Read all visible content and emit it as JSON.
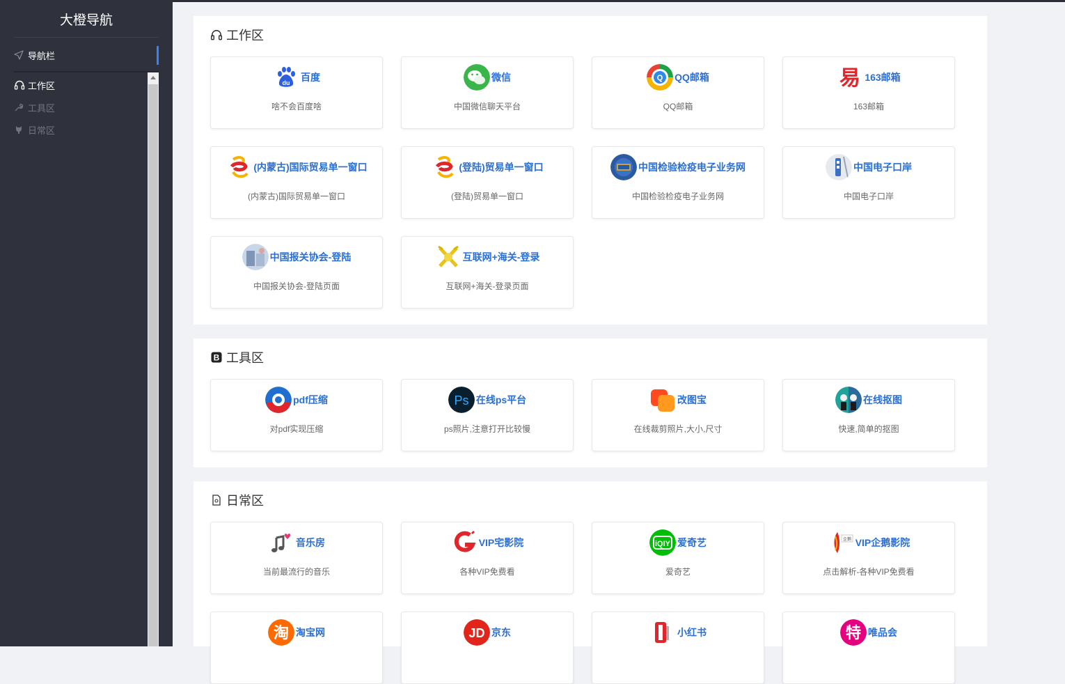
{
  "brand": "大橙导航",
  "nav": {
    "header_label": "导航栏",
    "items": [
      {
        "label": "工作区",
        "icon": "headset-icon",
        "active": true
      },
      {
        "label": "工具区",
        "icon": "wrench-icon",
        "active": false
      },
      {
        "label": "日常区",
        "icon": "github-icon",
        "active": false
      }
    ]
  },
  "sections": [
    {
      "title": "工作区",
      "icon": "headset-icon",
      "cards": [
        {
          "title": "百度",
          "desc": "啥不会百度啥",
          "logo": "baidu-logo"
        },
        {
          "title": "微信",
          "desc": "中国微信聊天平台",
          "logo": "wechat-logo"
        },
        {
          "title": "QQ邮箱",
          "desc": "QQ邮箱",
          "logo": "qq-mail-logo"
        },
        {
          "title": "163邮箱",
          "desc": "163邮箱",
          "logo": "netease-163-logo"
        },
        {
          "title": "(内蒙古)国际贸易单一窗口",
          "desc": "(内蒙古)国际贸易单一窗口",
          "logo": "single-window-logo"
        },
        {
          "title": "(登陆)贸易单一窗口",
          "desc": "(登陆)贸易单一窗口",
          "logo": "single-window-logo"
        },
        {
          "title": "中国检验检疫电子业务网",
          "desc": "中国检验检疫电子业务网",
          "logo": "ciq-logo"
        },
        {
          "title": "中国电子口岸",
          "desc": "中国电子口岸",
          "logo": "chinaport-logo"
        },
        {
          "title": "中国报关协会-登陆",
          "desc": "中国报关协会-登陆页面",
          "logo": "customs-assoc-logo"
        },
        {
          "title": "互联网+海关-登录",
          "desc": "互联网+海关-登录页面",
          "logo": "customs-emblem-logo"
        }
      ]
    },
    {
      "title": "工具区",
      "icon": "b-square-icon",
      "cards": [
        {
          "title": "pdf压缩",
          "desc": "对pdf实现压缩",
          "logo": "pdf-compress-logo"
        },
        {
          "title": "在线ps平台",
          "desc": "ps照片,注意打开比较慢",
          "logo": "photoshop-logo"
        },
        {
          "title": "改图宝",
          "desc": "在线裁剪照片,大小,尺寸",
          "logo": "gaitubao-logo"
        },
        {
          "title": "在线抠图",
          "desc": "快速,简单的抠图",
          "logo": "cutout-logo"
        }
      ]
    },
    {
      "title": "日常区",
      "icon": "document-icon",
      "cards": [
        {
          "title": "音乐房",
          "desc": "当前最流行的音乐",
          "logo": "music-logo"
        },
        {
          "title": "VIP宅影院",
          "desc": "各种VIP免费看",
          "logo": "vip-cinema-logo"
        },
        {
          "title": "爱奇艺",
          "desc": "爱奇艺",
          "logo": "iqiyi-logo"
        },
        {
          "title": "VIP企鹅影院",
          "desc": "点击解析-各种VIP免费看",
          "logo": "penguin-cinema-logo"
        },
        {
          "title": "淘宝网",
          "desc": "",
          "logo": "taobao-logo"
        },
        {
          "title": "京东",
          "desc": "",
          "logo": "jd-logo"
        },
        {
          "title": "小红书",
          "desc": "",
          "logo": "xiaohongshu-logo"
        },
        {
          "title": "唯品会",
          "desc": "",
          "logo": "vipshop-logo"
        }
      ]
    }
  ],
  "logo_text": {
    "baidu": "du",
    "qq": "Q",
    "netease": "易",
    "ps": "Ps",
    "iqiyi": "iQIY",
    "taobao": "淘",
    "jd": "JD",
    "vipshop": "特"
  },
  "colors": {
    "accent": "#2a6fd6",
    "sidebar_bg": "#2f323c",
    "nav_active_bar": "#3b82f6",
    "page_bg": "#f0f2f5"
  }
}
